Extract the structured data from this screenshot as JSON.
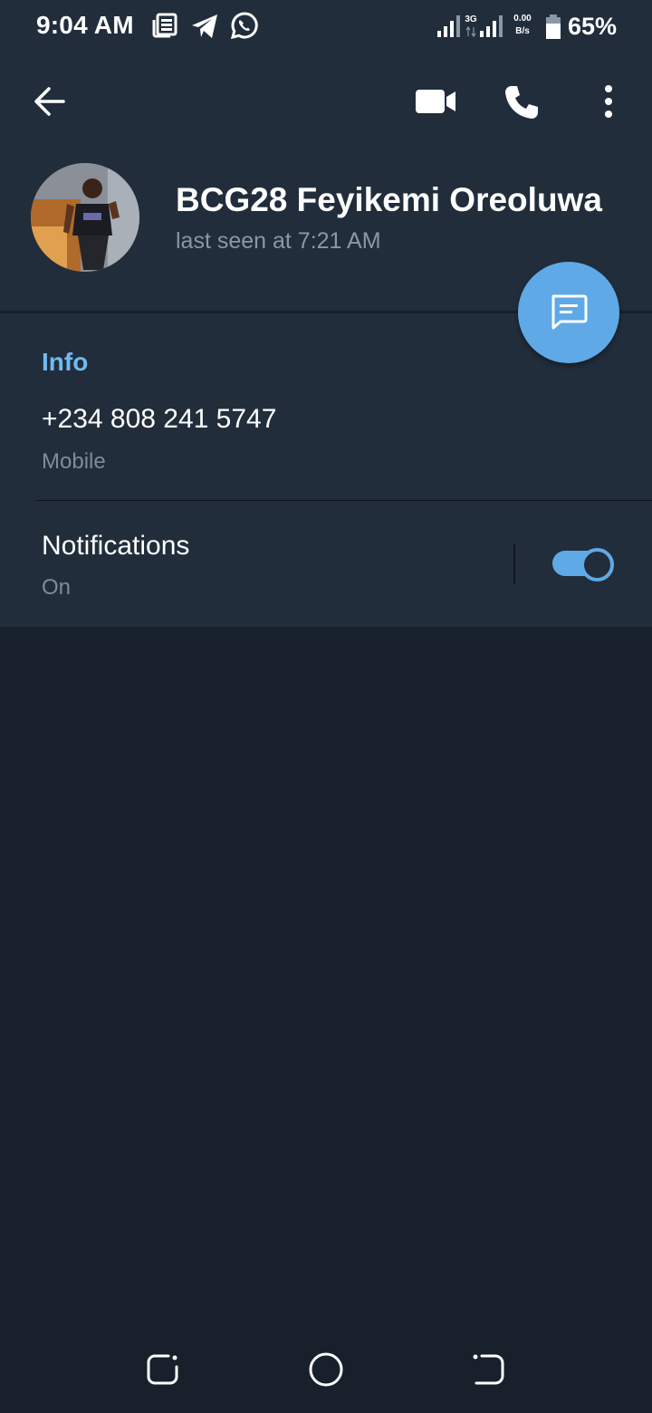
{
  "status_bar": {
    "time": "9:04 AM",
    "network_type": "3G",
    "net_speed_value": "0.00",
    "net_speed_unit": "B/s",
    "battery_percent": "65%",
    "notification_icons": [
      "news-icon",
      "telegram-icon",
      "whatsapp-icon"
    ]
  },
  "header": {
    "contact_name": "BCG28 Feyikemi Oreoluwa",
    "last_seen": "last seen at 7:21 AM"
  },
  "info": {
    "section_title": "Info",
    "phone_number": "+234 808 241 5747",
    "phone_label": "Mobile"
  },
  "notifications": {
    "title": "Notifications",
    "status": "On",
    "enabled": true
  },
  "colors": {
    "accent": "#5ea9e6",
    "header_bg": "#212d3b",
    "page_bg": "#17202b",
    "info_title": "#71baf2"
  }
}
